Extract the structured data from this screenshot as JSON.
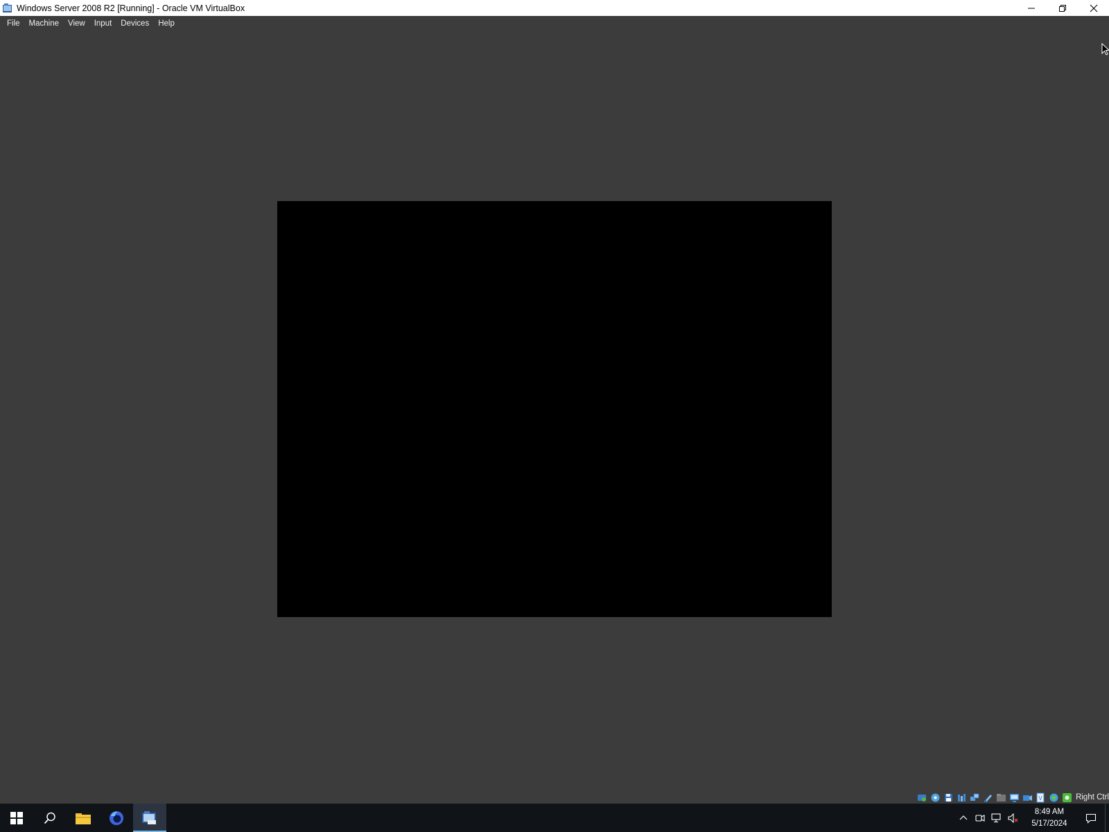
{
  "window": {
    "title": "Windows Server 2008 R2 [Running] - Oracle VM VirtualBox",
    "controls": [
      "minimize-icon",
      "restore-icon",
      "close-icon"
    ]
  },
  "menubar": {
    "items": [
      "File",
      "Machine",
      "View",
      "Input",
      "Devices",
      "Help"
    ]
  },
  "vm": {
    "state": "Running",
    "screen_color": "#000000",
    "background_color": "#3c3c3c"
  },
  "statusbar": {
    "icons": [
      "hard-disk-icon",
      "optical-drive-icon",
      "floppy-icon",
      "audio-icon",
      "network-icon",
      "usb-icon",
      "shared-folders-icon",
      "display-icon",
      "video-capture-icon",
      "recording-icon",
      "cpu-icon",
      "mouse-integration-icon",
      "keyboard-icon"
    ],
    "host_key": "Right Ctrl"
  },
  "taskbar": {
    "apps": [
      "start-icon",
      "search-icon",
      "file-explorer-icon",
      "firefox-icon",
      "virtualbox-icon"
    ],
    "tray_icons": [
      "chevron-up-icon",
      "meet-now-icon",
      "network-icon",
      "volume-muted-icon"
    ],
    "time": "8:49 AM",
    "date": "5/17/2024"
  }
}
